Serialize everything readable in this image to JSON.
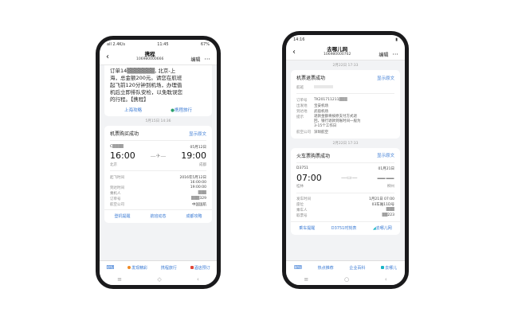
{
  "left": {
    "status": {
      "time": "11:45",
      "left": "all 2.4K/s",
      "right": "67%"
    },
    "header": {
      "title": "携程",
      "number": "106980000666",
      "edit": "编辑",
      "more": "···"
    },
    "msg_top": {
      "lines": [
        "订单14▒▒▒▒▒▒▒, 北京-上",
        "海，总金额200元。请您在航班",
        "起飞前120分钟到机场，办理值",
        "机后立即排队安检，以免耽误您",
        "的行程。【携程】"
      ],
      "link1": "上海攻略",
      "link2": "携程旅行"
    },
    "ts1": "5月15日 14:36",
    "card": {
      "title": "机票购买成功",
      "show_orig": "显示原文",
      "from_code": "C▒▒▒▒",
      "date": "05月12日",
      "dep_time": "16:00",
      "arr_time": "19:00",
      "from_city": "北京",
      "to_city": "成都",
      "rows": [
        {
          "k": "起飞时间",
          "v": "2016年5月12日"
        },
        {
          "k": "",
          "v": "16:00:00"
        },
        {
          "k": "到达时间",
          "v": "19:00:00"
        },
        {
          "k": "乘机人",
          "v": "▒▒▒"
        },
        {
          "k": "订单号",
          "v": "▒▒▒329"
        },
        {
          "k": "航空公司",
          "v": "中国国航"
        }
      ],
      "actions": [
        "登机提醒",
        "航班动态",
        "成都攻略"
      ]
    },
    "bottom": [
      "发现精彩",
      "携程旅行",
      "酒店预订"
    ]
  },
  "right": {
    "status": {
      "time": "14:16",
      "right": "▮"
    },
    "header": {
      "title": "去哪儿网",
      "number": "106980000762",
      "edit": "编辑",
      "more": "···"
    },
    "ts1": "2月22日 17:33",
    "card1": {
      "title": "机票退票成功",
      "show_orig": "显示原文",
      "first_label": "航班",
      "rows": [
        {
          "k": "订单号",
          "v": "TK201711211▒▒▒"
        },
        {
          "k": "出发地",
          "v": "宝安机场"
        },
        {
          "k": "到达地",
          "v": "武宿机场"
        },
        {
          "k": "提示",
          "v": "退款金额将按原支付方式退回，银行退款到账时间一般为3-15个工作日"
        },
        {
          "k": "航空公司",
          "v": "深圳航空"
        }
      ]
    },
    "ts2": "2月22日 17:33",
    "card2": {
      "title": "火车票购票成功",
      "show_orig": "显示原文",
      "train": "D3751",
      "date": "01月21日",
      "dep_time": "07:00",
      "arr_time": "——",
      "from_city": "桂林",
      "to_city": "柳州",
      "rows": [
        {
          "k": "发车时间",
          "v": "1月21日 07:00"
        },
        {
          "k": "座位",
          "v": "03车厢11D号"
        },
        {
          "k": "乘车人",
          "v": "▒▒▒"
        },
        {
          "k": "取票号",
          "v": "▒▒223"
        }
      ],
      "actions": [
        "乘车提醒",
        "D3751时刻表",
        "去哪儿网"
      ]
    },
    "bottom": [
      "热点推荐",
      "企业百科",
      "去哪儿"
    ]
  }
}
